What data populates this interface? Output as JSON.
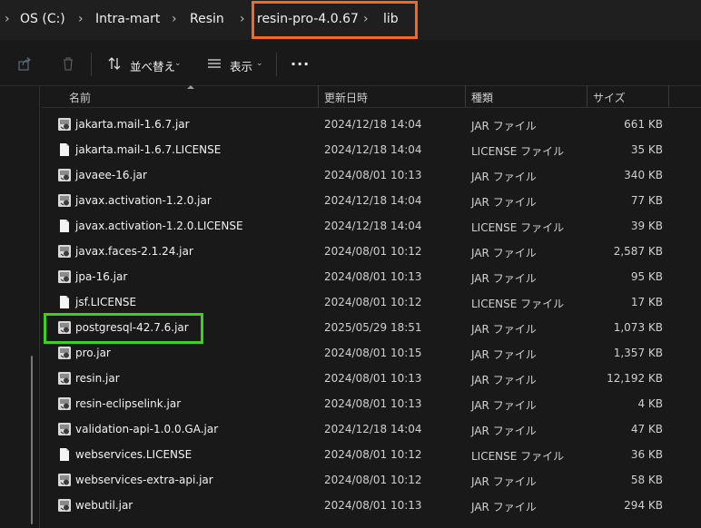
{
  "breadcrumb": [
    "OS (C:)",
    "Intra-mart",
    "Resin",
    "resin-pro-4.0.67",
    "lib"
  ],
  "toolbar": {
    "sort_label": "並べ替え",
    "view_label": "表示",
    "more_label": "..."
  },
  "columns": {
    "name": "名前",
    "date": "更新日時",
    "type": "種類",
    "size": "サイズ"
  },
  "files": [
    {
      "name": "jakarta.mail-1.6.7.jar",
      "date": "2024/12/18 14:04",
      "type": "JAR ファイル",
      "size": "661 KB",
      "icon": "jar-file-icon"
    },
    {
      "name": "jakarta.mail-1.6.7.LICENSE",
      "date": "2024/12/18 14:04",
      "type": "LICENSE ファイル",
      "size": "35 KB",
      "icon": "generic-file-icon"
    },
    {
      "name": "javaee-16.jar",
      "date": "2024/08/01 10:13",
      "type": "JAR ファイル",
      "size": "340 KB",
      "icon": "jar-file-icon"
    },
    {
      "name": "javax.activation-1.2.0.jar",
      "date": "2024/12/18 14:04",
      "type": "JAR ファイル",
      "size": "77 KB",
      "icon": "jar-file-icon"
    },
    {
      "name": "javax.activation-1.2.0.LICENSE",
      "date": "2024/12/18 14:04",
      "type": "LICENSE ファイル",
      "size": "39 KB",
      "icon": "generic-file-icon"
    },
    {
      "name": "javax.faces-2.1.24.jar",
      "date": "2024/08/01 10:12",
      "type": "JAR ファイル",
      "size": "2,587 KB",
      "icon": "jar-file-icon"
    },
    {
      "name": "jpa-16.jar",
      "date": "2024/08/01 10:13",
      "type": "JAR ファイル",
      "size": "95 KB",
      "icon": "jar-file-icon"
    },
    {
      "name": "jsf.LICENSE",
      "date": "2024/08/01 10:12",
      "type": "LICENSE ファイル",
      "size": "17 KB",
      "icon": "generic-file-icon"
    },
    {
      "name": "postgresql-42.7.6.jar",
      "date": "2025/05/29 18:51",
      "type": "JAR ファイル",
      "size": "1,073 KB",
      "icon": "jar-file-icon"
    },
    {
      "name": "pro.jar",
      "date": "2024/08/01 10:15",
      "type": "JAR ファイル",
      "size": "1,357 KB",
      "icon": "jar-file-icon"
    },
    {
      "name": "resin.jar",
      "date": "2024/08/01 10:13",
      "type": "JAR ファイル",
      "size": "12,192 KB",
      "icon": "jar-file-icon"
    },
    {
      "name": "resin-eclipselink.jar",
      "date": "2024/08/01 10:13",
      "type": "JAR ファイル",
      "size": "4 KB",
      "icon": "jar-file-icon"
    },
    {
      "name": "validation-api-1.0.0.GA.jar",
      "date": "2024/12/18 14:04",
      "type": "JAR ファイル",
      "size": "47 KB",
      "icon": "jar-file-icon"
    },
    {
      "name": "webservices.LICENSE",
      "date": "2024/08/01 10:12",
      "type": "LICENSE ファイル",
      "size": "36 KB",
      "icon": "generic-file-icon"
    },
    {
      "name": "webservices-extra-api.jar",
      "date": "2024/08/01 10:12",
      "type": "JAR ファイル",
      "size": "58 KB",
      "icon": "jar-file-icon"
    },
    {
      "name": "webutil.jar",
      "date": "2024/08/01 10:13",
      "type": "JAR ファイル",
      "size": "294 KB",
      "icon": "jar-file-icon"
    }
  ],
  "colors": {
    "highlight_path": "#f26a21",
    "highlight_file": "#3fcf1f"
  }
}
